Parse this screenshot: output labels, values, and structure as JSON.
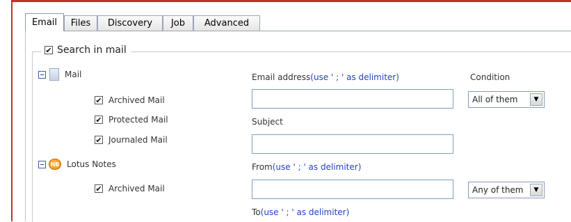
{
  "tabs": [
    {
      "label": "Email",
      "active": true
    },
    {
      "label": "Files",
      "active": false
    },
    {
      "label": "Discovery",
      "active": false
    },
    {
      "label": "Job",
      "active": false
    },
    {
      "label": "Advanced",
      "active": false
    }
  ],
  "search_group": {
    "label": "Search in mail",
    "checked": true,
    "check_glyph": "✔"
  },
  "tree": {
    "mail": {
      "label": "Mail",
      "icon": "mail-icon"
    },
    "mail_children": [
      {
        "label": "Archived Mail",
        "checked": true
      },
      {
        "label": "Protected Mail",
        "checked": true
      },
      {
        "label": "Journaled Mail",
        "checked": true
      }
    ],
    "lotus": {
      "label": "Lotus Notes",
      "icon": "lotus-notes-icon",
      "icon_text": "NB"
    },
    "lotus_children": [
      {
        "label": "Archived Mail",
        "checked": true
      }
    ]
  },
  "form": {
    "email_label": "Email address",
    "email_hint": "(use ' ; ' as delimiter)",
    "condition_label": "Condition",
    "email_condition": "All of them",
    "subject_label": "Subject",
    "from_label": "From",
    "from_hint": "(use ' ; ' as delimiter)",
    "from_condition": "Any of them",
    "to_label": "To",
    "to_hint": "(use ' ; ' as delimiter)",
    "dropdown_glyph": "▼"
  },
  "colors": {
    "frame": "#c72e2e",
    "hint": "#2340c0",
    "input_border": "#7f9db9"
  }
}
